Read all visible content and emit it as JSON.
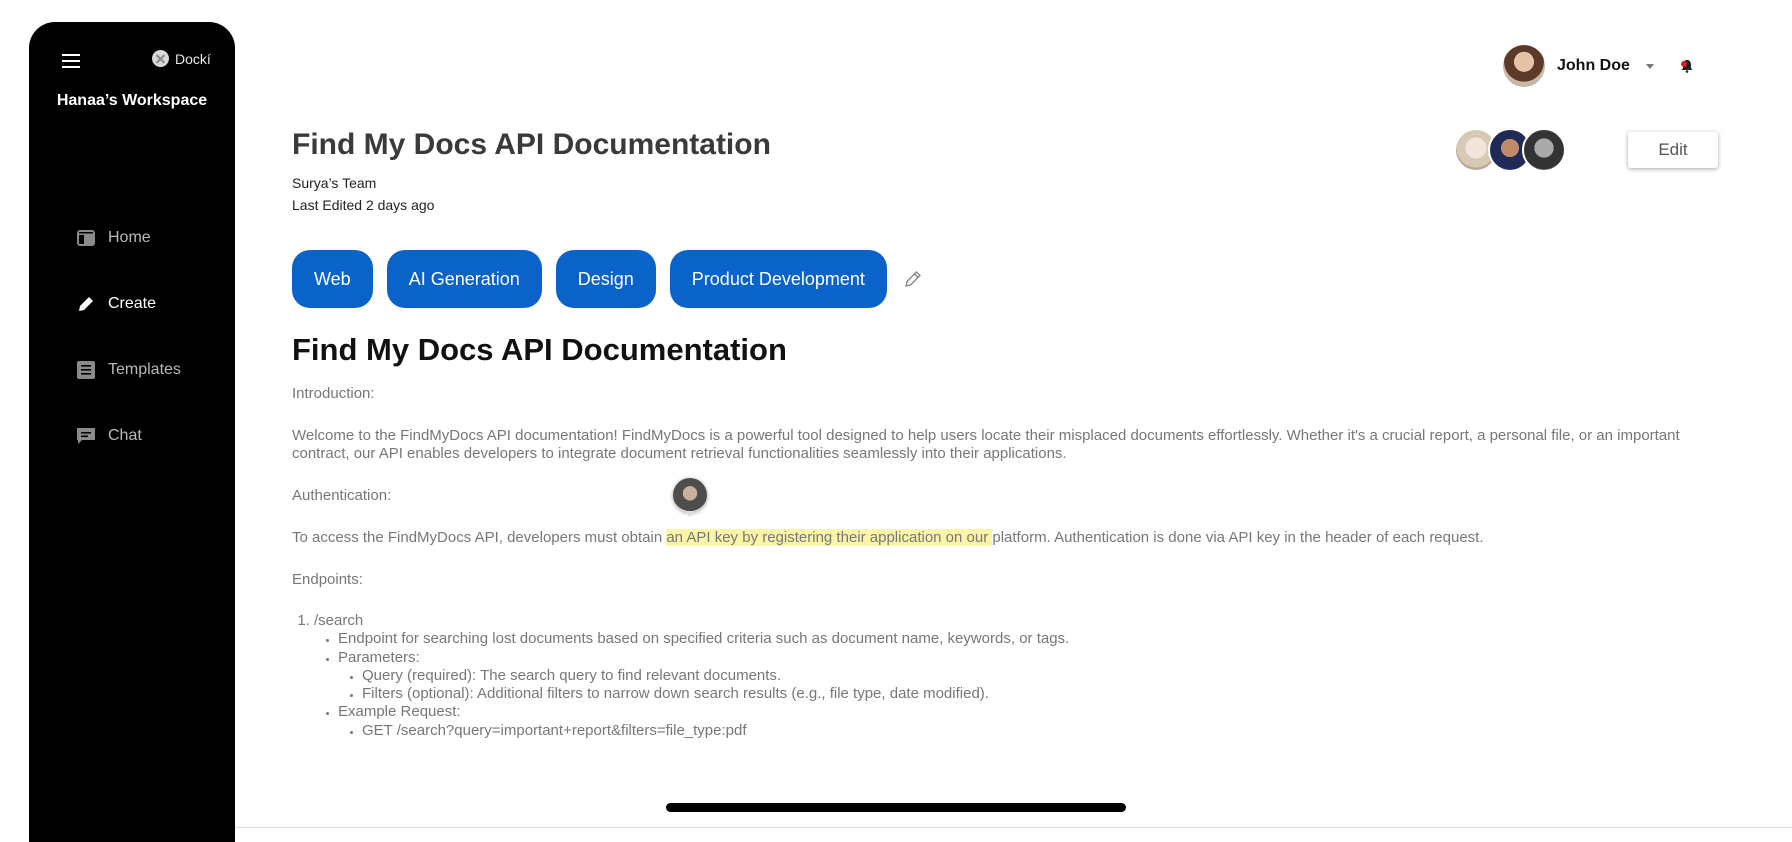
{
  "sidebar": {
    "brand": "Dockí",
    "workspace": "Hanaa’s Workspace",
    "items": [
      {
        "label": "Home",
        "icon": "dashboard-icon"
      },
      {
        "label": "Create",
        "icon": "pencil-icon"
      },
      {
        "label": "Templates",
        "icon": "list-icon"
      },
      {
        "label": "Chat",
        "icon": "chat-icon"
      }
    ]
  },
  "header": {
    "user_name": "John Doe",
    "edit_label": "Edit"
  },
  "doc": {
    "title": "Find My Docs API Documentation",
    "team": "Surya’s Team",
    "last_edited": "Last Edited 2 days ago",
    "tags": [
      "Web",
      "AI Generation",
      "Design",
      "Product Development"
    ]
  },
  "content": {
    "heading": "Find My Docs API Documentation",
    "intro_label": "Introduction:",
    "intro_text": "Welcome to the FindMyDocs API documentation! FindMyDocs is a powerful tool designed to help users locate their misplaced documents effortlessly. Whether it's a crucial report, a personal file, or an important contract, our API enables developers to integrate document retrieval functionalities seamlessly into their applications.",
    "auth_label": "Authentication:",
    "auth_before": "To access the FindMyDocs API, developers must obtain ",
    "auth_highlight": "an API key by registering their application on our ",
    "auth_after": "platform. Authentication is done via API key in the header of each request.",
    "endpoints_label": "Endpoints:",
    "endpoint_1": "/search",
    "endpoint_1_desc": "Endpoint for searching lost documents based on specified criteria such as document name, keywords, or tags.",
    "parameters_label": "Parameters:",
    "param_query": "Query (required): The search query to find relevant documents.",
    "param_filters": "Filters (optional): Additional filters to narrow down search results (e.g., file type, date modified).",
    "example_label": "Example Request:",
    "example_request": "GET /search?query=important+report&filters=file_type:pdf"
  },
  "colors": {
    "sidebar_bg": "#000000",
    "tag_bg": "#0a63c9",
    "highlight": "#fbf5a8"
  }
}
